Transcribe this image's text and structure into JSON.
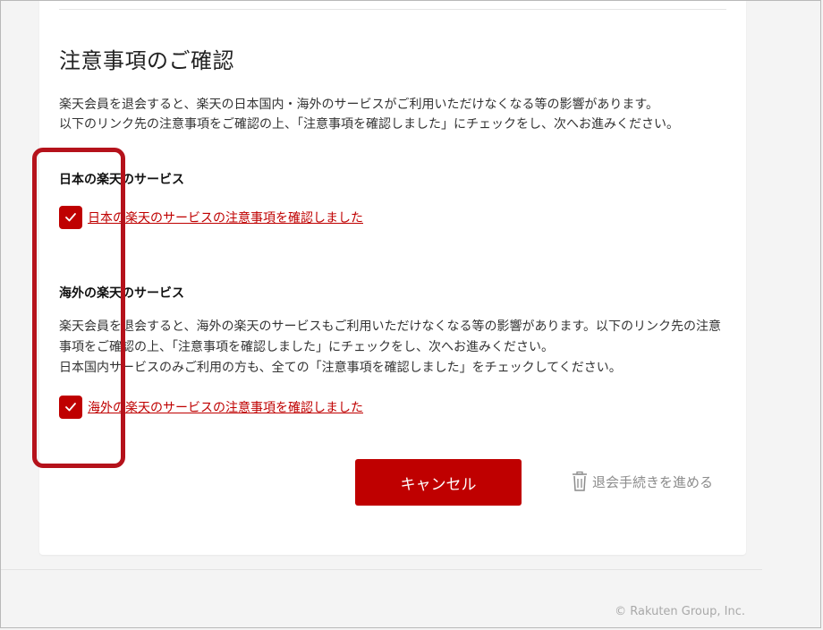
{
  "notice": {
    "heading": "注意事項のご確認",
    "intro_line1": "楽天会員を退会すると、楽天の日本国内・海外のサービスがご利用いただけなくなる等の影響があります。",
    "intro_line2": "以下のリンク先の注意事項をご確認の上、「注意事項を確認しました」にチェックをし、次へお進みください。"
  },
  "japan_section": {
    "title": "日本の楽天のサービス",
    "checkbox_checked": true,
    "confirm_link": "日本の楽天のサービスの注意事項を確認しました"
  },
  "overseas_section": {
    "title": "海外の楽天のサービス",
    "description_line1": "楽天会員を退会すると、海外の楽天のサービスもご利用いただけなくなる等の影響があります。以下のリンク先の注意事項をご確認の上、「注意事項を確認しました」にチェックをし、次へお進みください。",
    "description_line2": "日本国内サービスのみご利用の方も、全ての「注意事項を確認しました」をチェックしてください。",
    "checkbox_checked": true,
    "confirm_link": "海外の楽天のサービスの注意事項を確認しました"
  },
  "actions": {
    "cancel_label": "キャンセル",
    "withdraw_label": "退会手続きを進める"
  },
  "footer": {
    "copyright": "© Rakuten Group, Inc."
  },
  "colors": {
    "brand_red": "#bf0000",
    "annotation_red": "#b5121b",
    "muted_gray": "#8c8c8c"
  },
  "icons": {
    "checkbox": "checkmark-icon",
    "withdraw": "trash-icon"
  }
}
